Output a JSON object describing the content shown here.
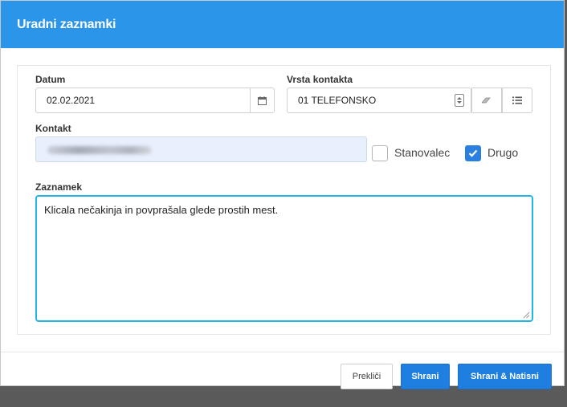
{
  "dialog": {
    "title": "Uradni zaznamki"
  },
  "form": {
    "date_label": "Datum",
    "date_value": "02.02.2021",
    "contact_type_label": "Vrsta kontakta",
    "contact_type_value": "01 TELEFONSKO",
    "contact_label": "Kontakt",
    "checkboxes": [
      {
        "label": "Stanovalec",
        "checked": false
      },
      {
        "label": "Drugo",
        "checked": true
      }
    ],
    "note_label": "Zaznamek",
    "note_value": "Klicala nečakinja in povprašala glede prostih mest."
  },
  "footer": {
    "cancel_label": "Prekliči",
    "save_label": "Shrani",
    "save_print_label": "Shrani & Natisni"
  },
  "colors": {
    "header": "#2b95e9",
    "primary_button": "#1e7fe0",
    "focus_border": "#22b6e8",
    "autofill_bg": "#e8f0fe"
  },
  "icons": [
    "calendar-icon",
    "spinner-icon",
    "eraser-icon",
    "list-icon",
    "checkmark-icon",
    "resize-handle-icon"
  ]
}
